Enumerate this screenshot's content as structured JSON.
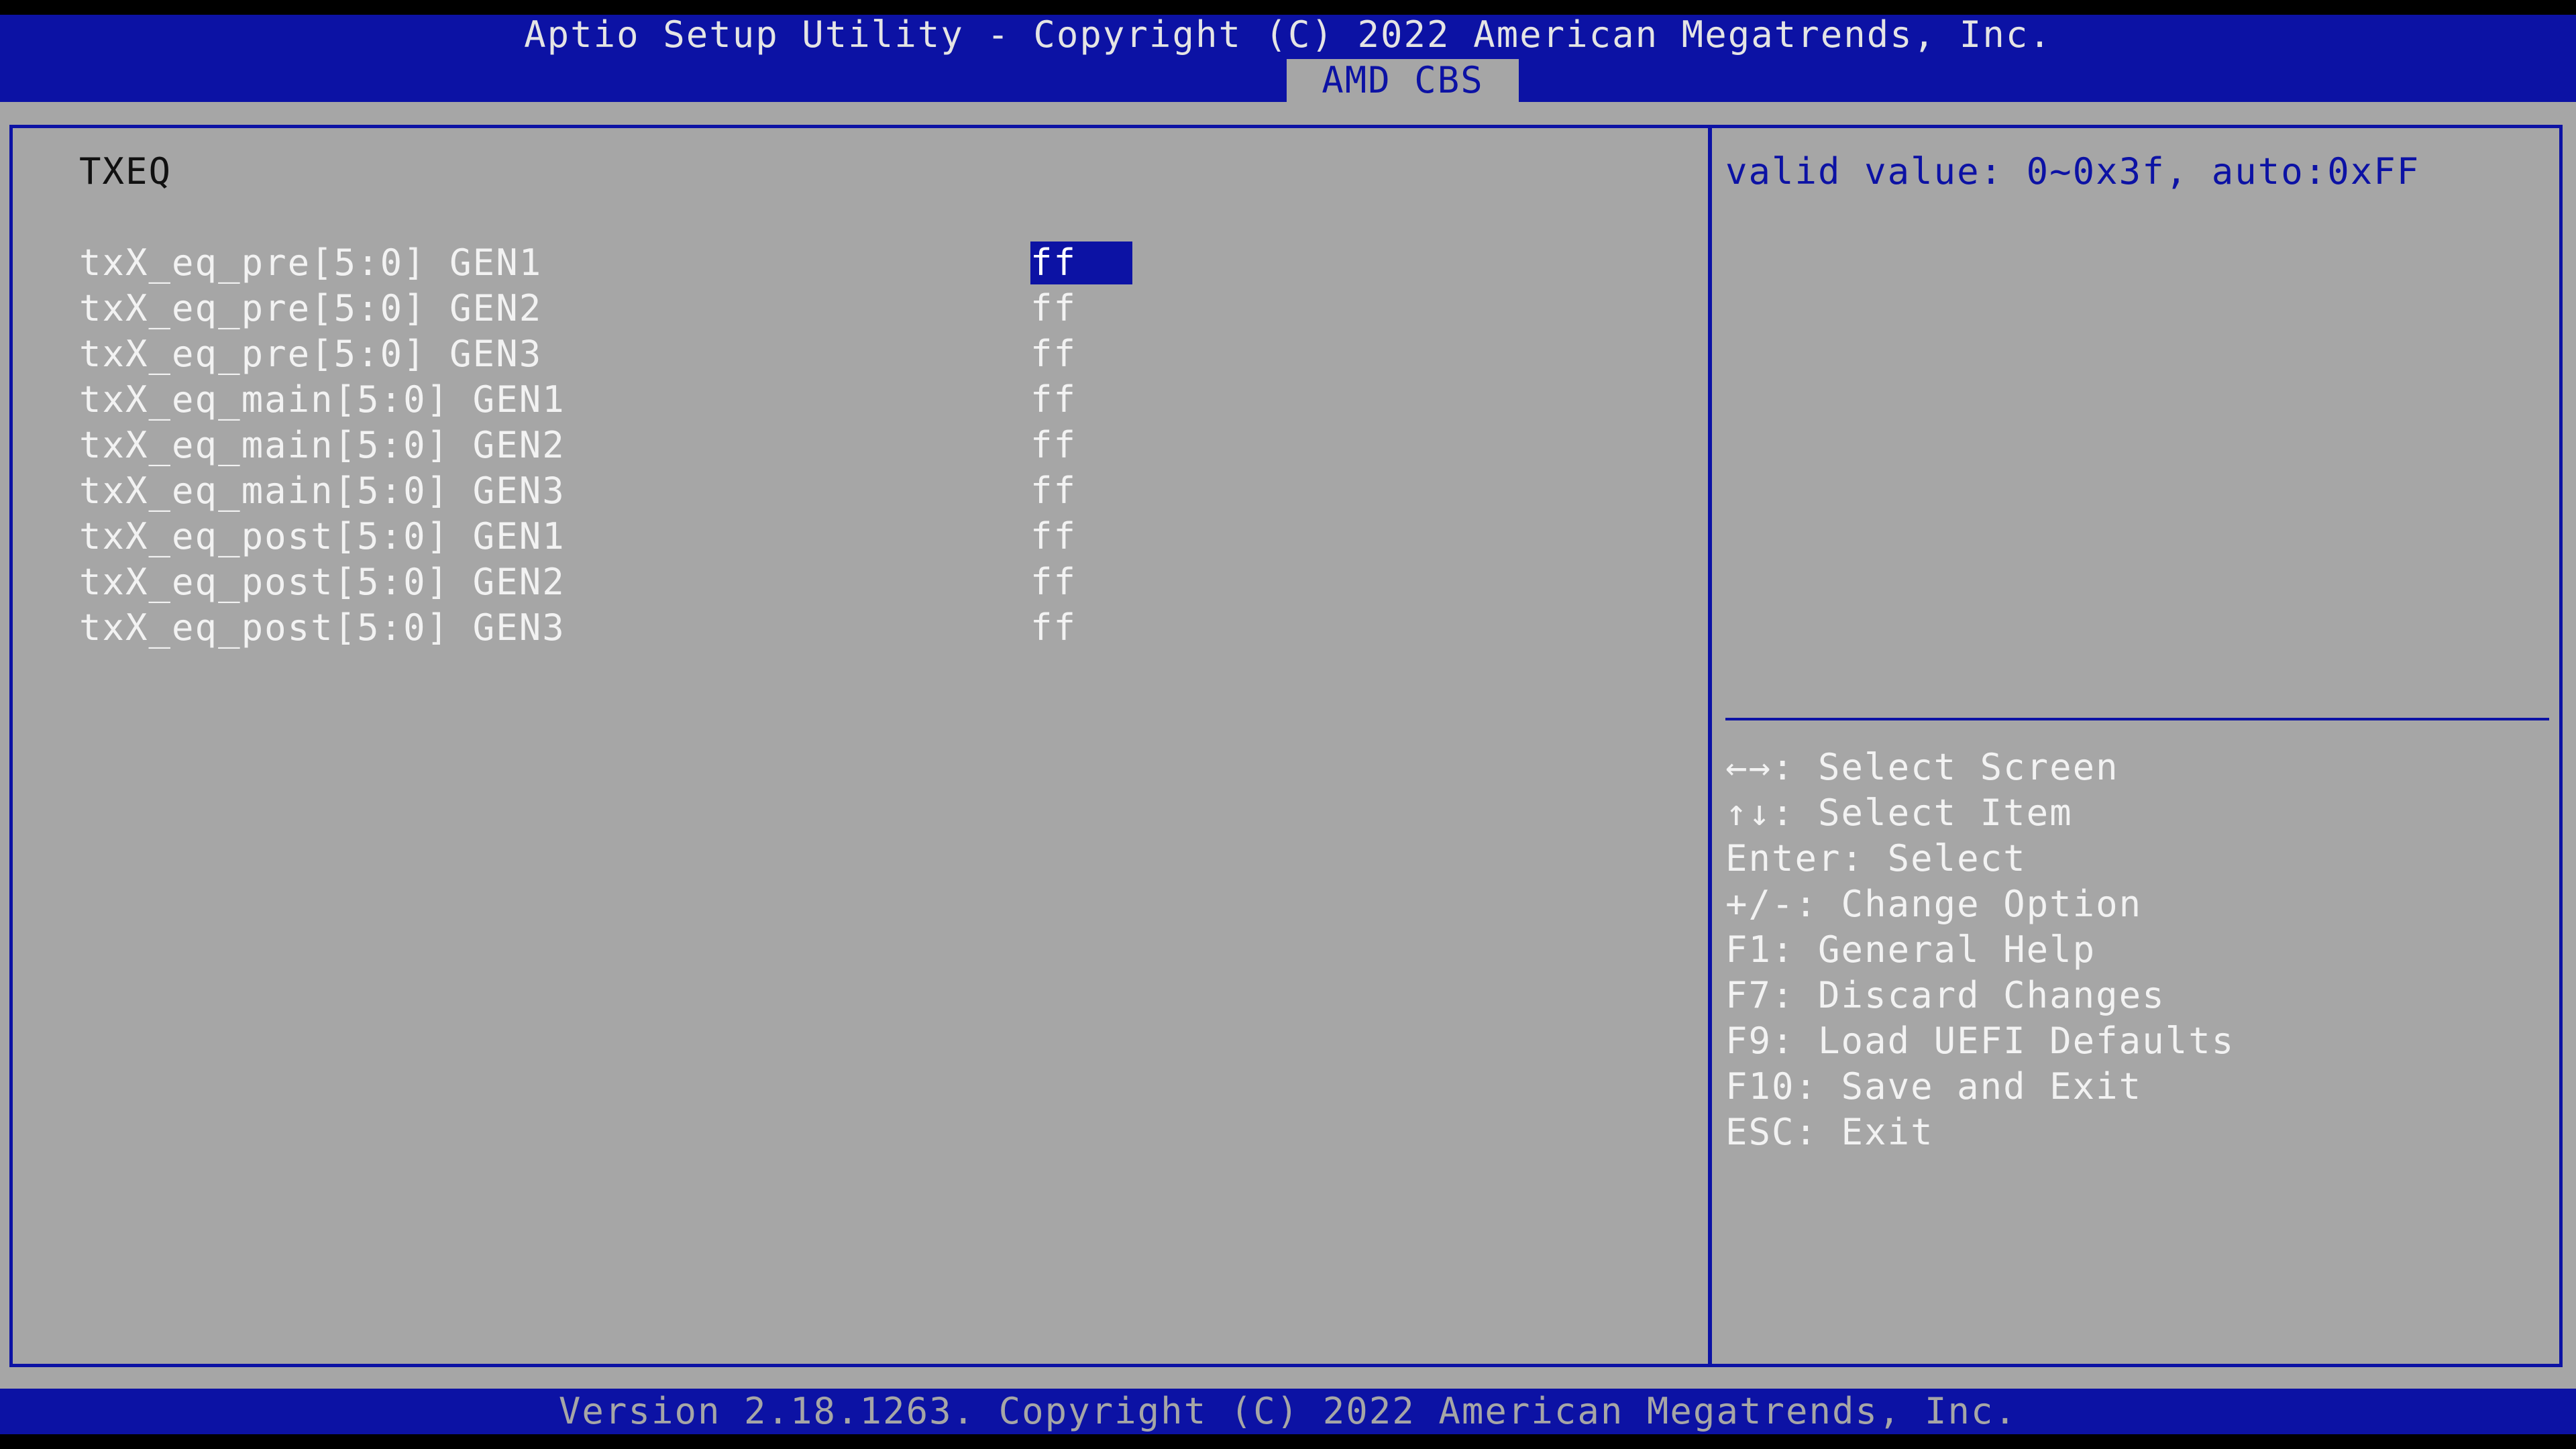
{
  "header": {
    "title": "Aptio Setup Utility - Copyright (C) 2022 American Megatrends, Inc.",
    "active_tab": "AMD CBS"
  },
  "main": {
    "section_title": "TXEQ",
    "settings": [
      {
        "label": "txX_eq_pre[5:0] GEN1",
        "value": "ff"
      },
      {
        "label": "txX_eq_pre[5:0] GEN2",
        "value": "ff"
      },
      {
        "label": "txX_eq_pre[5:0] GEN3",
        "value": "ff"
      },
      {
        "label": "txX_eq_main[5:0] GEN1",
        "value": "ff"
      },
      {
        "label": "txX_eq_main[5:0] GEN2",
        "value": "ff"
      },
      {
        "label": "txX_eq_main[5:0] GEN3",
        "value": "ff"
      },
      {
        "label": "txX_eq_post[5:0] GEN1",
        "value": "ff"
      },
      {
        "label": "txX_eq_post[5:0] GEN2",
        "value": "ff"
      },
      {
        "label": "txX_eq_post[5:0] GEN3",
        "value": "ff"
      }
    ]
  },
  "help": {
    "description": "valid value: 0~0x3f, auto:0xFF",
    "keys": [
      "←→: Select Screen",
      "↑↓: Select Item",
      "Enter: Select",
      "+/-: Change Option",
      "F1: General Help",
      "F7: Discard Changes",
      "F9: Load UEFI Defaults",
      "F10: Save and Exit",
      "ESC: Exit"
    ]
  },
  "footer": {
    "text": "Version 2.18.1263. Copyright (C) 2022 American Megatrends, Inc."
  },
  "colors": {
    "bios_blue": "#0c12a4",
    "panel_gray": "#a6a6a6",
    "text_white": "#f2f2f2",
    "text_dark": "#111111"
  }
}
